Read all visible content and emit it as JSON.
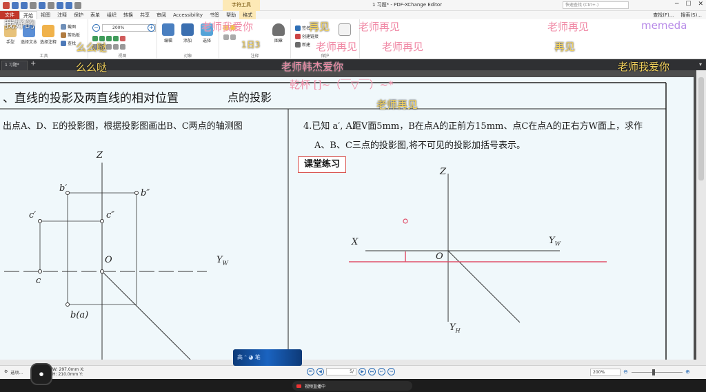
{
  "window": {
    "title": "1 习题* - PDF-XChange Editor",
    "context_tab_header": "字符工具",
    "search_placeholder": "快速查找 (Ctrl+.)",
    "right_links": [
      "查找(F)...",
      "搜索(S)..."
    ]
  },
  "ribbon_tabs": [
    "文件",
    "开始",
    "视图",
    "注释",
    "保护",
    "表单",
    "组织",
    "转换",
    "共享",
    "审阅",
    "Accessibility",
    "书签",
    "帮助",
    "格式"
  ],
  "ribbon": {
    "groups": [
      "工具",
      "视图",
      "对象",
      "注释",
      "保护"
    ],
    "buttons": {
      "hand": "手型",
      "select_text": "选择文本",
      "select_comment": "选择注释",
      "screenshot": "截图",
      "clipboard": "剪贴板",
      "find": "查找",
      "zoom_value": "200%",
      "edit": "编辑",
      "add": "添加",
      "select": "选择",
      "stamp": "图章",
      "sign": "签名",
      "create_link": "创建链接",
      "new": "新建"
    }
  },
  "document_tab": "1 习题*",
  "page": {
    "title": "、直线的投影及两直线的相对位置",
    "subtitle": "点的投影",
    "left_question": "出点A、D、E的投影图，根据投影图画出B、C两点的轴测图",
    "right_question_line1": "4.已知 a′, A距V面5mm，B在点A的正前方15mm、点C在点A的正右方W面上，求作",
    "right_question_line2": "A、B、C三点的投影图,将不可见的投影加括号表示。",
    "practice_label": "课堂练习"
  },
  "diagram_labels": {
    "left": {
      "z": "Z",
      "b_prime": "b′",
      "b_double_prime": "b″",
      "c_prime": "c′",
      "c_double_prime": "c″",
      "o": "O",
      "yw": "Y",
      "yw_sub": "W",
      "c": "c",
      "b_a": "b(a)"
    },
    "right": {
      "z": "Z",
      "x": "X",
      "yw": "Y",
      "yw_sub": "W",
      "o": "O",
      "yh": "Y",
      "yh_sub": "H"
    }
  },
  "statusbar": {
    "left_label": "选项...",
    "coord_w": "W: 297.0mm",
    "coord_h": "H: 210.0mm",
    "coord_x": "X:",
    "coord_y": "Y:",
    "page_indicator": "5/",
    "zoom": "200%"
  },
  "taskbar": {
    "recording_label": "视频直播中"
  },
  "overlays": {
    "rec_badge": "⏺",
    "float_pill": "高 ᵔ ◕ 笔"
  },
  "danmu": [
    {
      "text": "我好的",
      "cls": "dm-white"
    },
    {
      "text": "么么哒",
      "cls": "dm-yellow"
    },
    {
      "text": "么么哒",
      "cls": "dm-yellow"
    },
    {
      "text": "老师我爱你",
      "cls": "dm-pink"
    },
    {
      "text": "再见",
      "cls": "dm-yellow"
    },
    {
      "text": "老师再见",
      "cls": "dm-pink"
    },
    {
      "text": "老师再见",
      "cls": "dm-pink"
    },
    {
      "text": "老师再见",
      "cls": "dm-pink"
    },
    {
      "text": "老师再见",
      "cls": "dm-pink"
    },
    {
      "text": "memeda",
      "cls": "dm-purple"
    },
    {
      "text": "再见",
      "cls": "dm-yellow"
    },
    {
      "text": "老师我爱你",
      "cls": "dm-yellow"
    },
    {
      "text": "老师韩杰爱你",
      "cls": "dm-pink"
    },
    {
      "text": "乾杯 []~（￣▽￣）~*",
      "cls": "dm-pink"
    },
    {
      "text": "老师再见",
      "cls": "dm-yellow"
    },
    {
      "text": "1日3",
      "cls": "dm-yellow"
    }
  ],
  "colors": {
    "page_bg": "#f0f8fb",
    "practice_border": "#d9534f",
    "accent_red": "#e0506a",
    "file_tab": "#c2372b"
  }
}
